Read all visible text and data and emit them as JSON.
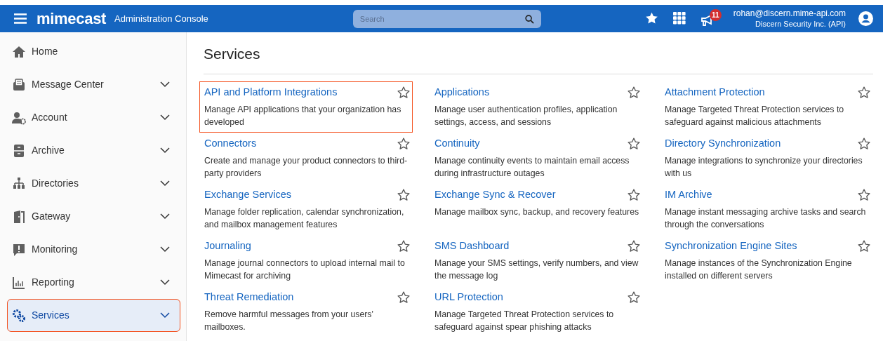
{
  "header": {
    "brand": "mimecast",
    "title": "Administration Console",
    "search": {
      "placeholder": "Search"
    },
    "notifications_count": "11",
    "user": {
      "email": "rohan@discern.mime-api.com",
      "org": "Discern Security Inc. (API)"
    }
  },
  "sidebar": {
    "items": [
      {
        "label": "Home",
        "expandable": false,
        "selected": false,
        "highlighted": false
      },
      {
        "label": "Message Center",
        "expandable": true,
        "selected": false,
        "highlighted": false
      },
      {
        "label": "Account",
        "expandable": true,
        "selected": false,
        "highlighted": false
      },
      {
        "label": "Archive",
        "expandable": true,
        "selected": false,
        "highlighted": false
      },
      {
        "label": "Directories",
        "expandable": true,
        "selected": false,
        "highlighted": false
      },
      {
        "label": "Gateway",
        "expandable": true,
        "selected": false,
        "highlighted": false
      },
      {
        "label": "Monitoring",
        "expandable": true,
        "selected": false,
        "highlighted": false
      },
      {
        "label": "Reporting",
        "expandable": true,
        "selected": false,
        "highlighted": false
      },
      {
        "label": "Services",
        "expandable": true,
        "selected": true,
        "highlighted": true
      }
    ]
  },
  "page_title": "Services",
  "services": [
    {
      "title": "API and Platform Integrations",
      "description": "Manage API applications that your organization has developed",
      "favorite": false,
      "highlighted": true
    },
    {
      "title": "Applications",
      "description": "Manage user authentication profiles, application settings, access, and sessions",
      "favorite": false,
      "highlighted": false
    },
    {
      "title": "Attachment Protection",
      "description": "Manage Targeted Threat Protection services to safeguard against malicious attachments",
      "favorite": false,
      "highlighted": false
    },
    {
      "title": "Connectors",
      "description": "Create and manage your product connectors to third-party providers",
      "favorite": false,
      "highlighted": false
    },
    {
      "title": "Continuity",
      "description": "Manage continuity events to maintain email access during infrastructure outages",
      "favorite": false,
      "highlighted": false
    },
    {
      "title": "Directory Synchronization",
      "description": "Manage integrations to synchronize your directories with us",
      "favorite": false,
      "highlighted": false
    },
    {
      "title": "Exchange Services",
      "description": "Manage folder replication, calendar synchronization, and mailbox management features",
      "favorite": false,
      "highlighted": false
    },
    {
      "title": "Exchange Sync & Recover",
      "description": "Manage mailbox sync, backup, and recovery features",
      "favorite": false,
      "highlighted": false
    },
    {
      "title": "IM Archive",
      "description": "Manage instant messaging archive tasks and search through the conversations",
      "favorite": false,
      "highlighted": false
    },
    {
      "title": "Journaling",
      "description": "Manage journal connectors to upload internal mail to Mimecast for archiving",
      "favorite": false,
      "highlighted": false
    },
    {
      "title": "SMS Dashboard",
      "description": "Manage your SMS settings, verify numbers, and view the message log",
      "favorite": false,
      "highlighted": false
    },
    {
      "title": "Synchronization Engine Sites",
      "description": "Manage instances of the Synchronization Engine installed on different servers",
      "favorite": false,
      "highlighted": false
    },
    {
      "title": "Threat Remediation",
      "description": "Remove harmful messages from your users' mailboxes.",
      "favorite": false,
      "highlighted": false
    },
    {
      "title": "URL Protection",
      "description": "Manage Targeted Threat Protection services to safeguard against spear phishing attacks",
      "favorite": false,
      "highlighted": false
    }
  ]
}
